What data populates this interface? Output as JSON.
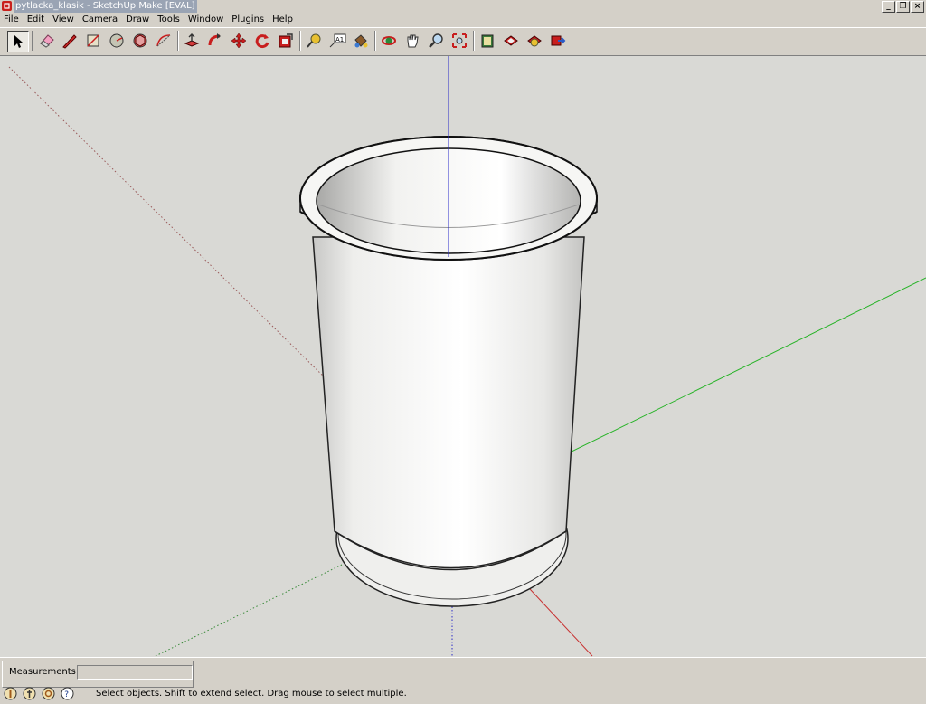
{
  "window": {
    "title": "pytlacka_klasik - SketchUp Make [EVAL]"
  },
  "menu": [
    "File",
    "Edit",
    "View",
    "Camera",
    "Draw",
    "Tools",
    "Window",
    "Plugins",
    "Help"
  ],
  "toolbar": {
    "tools": [
      "select-tool",
      "eraser-tool",
      "pencil-line-tool",
      "rectangle-tool",
      "circle-tool",
      "polygon-tool",
      "arc-tool",
      "push-pull-tool",
      "follow-me-tool",
      "move-tool",
      "rotate-tool",
      "offset-tool",
      "tape-measure-tool",
      "text-tool",
      "paint-bucket-tool",
      "orbit-tool",
      "pan-tool",
      "zoom-tool",
      "zoom-extents-tool",
      "3d-warehouse-icon",
      "share-model-icon",
      "get-models-icon",
      "share-component-icon"
    ]
  },
  "colors": {
    "axis_blue": "#2a2ac8",
    "axis_green": "#27b327",
    "axis_red": "#c83232",
    "model_face": "#f6f6f4"
  },
  "status": {
    "measurements_label": "Measurements",
    "measurements_value": "",
    "hint": "Select objects. Shift to extend select. Drag mouse to select multiple."
  }
}
